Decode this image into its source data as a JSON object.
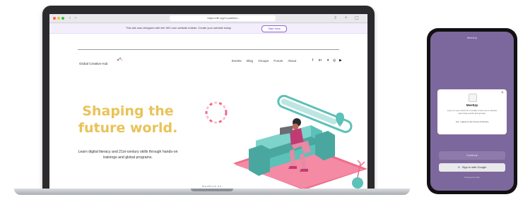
{
  "browser": {
    "url": "https://dlf.org/1t-platform",
    "back_glyph": "‹",
    "forward_glyph": "›"
  },
  "banner": {
    "text": "This site was designed with the WiX.com website builder. Create your website today.",
    "button": "Start Now"
  },
  "site": {
    "logo_text": "Global Creative Hub",
    "nav": [
      "Events",
      "Blog",
      "Groups",
      "Forum",
      "About"
    ],
    "social_icons": [
      "facebook-icon",
      "linkedin-icon",
      "twitter-icon",
      "instagram-icon",
      "youtube-icon"
    ],
    "hero_title_line1": "Shaping the",
    "hero_title_line2": "future world.",
    "hero_body": "Learn digital literacy and 21st-century skills through hands-on trainings and global programs."
  },
  "laptop": {
    "brand": "MacBook Air"
  },
  "phone": {
    "top_label": "MeetUp",
    "dialog_title": "MeetUp",
    "dialog_body": "Log in to your account or create a new one to access upcoming events and groups.",
    "dialog_consent": "Yes, I agree to the Terms & Privacy",
    "continue_button": "Continue",
    "google_button": "Sign in with Google",
    "footer": "Powered by Wix"
  },
  "colors": {
    "accent_purple": "#8f64d6",
    "hero_yellow": "#e9c358",
    "phone_bg": "#7c689d",
    "illustration_teal": "#5cc1b8",
    "illustration_pink": "#f06b8a"
  }
}
